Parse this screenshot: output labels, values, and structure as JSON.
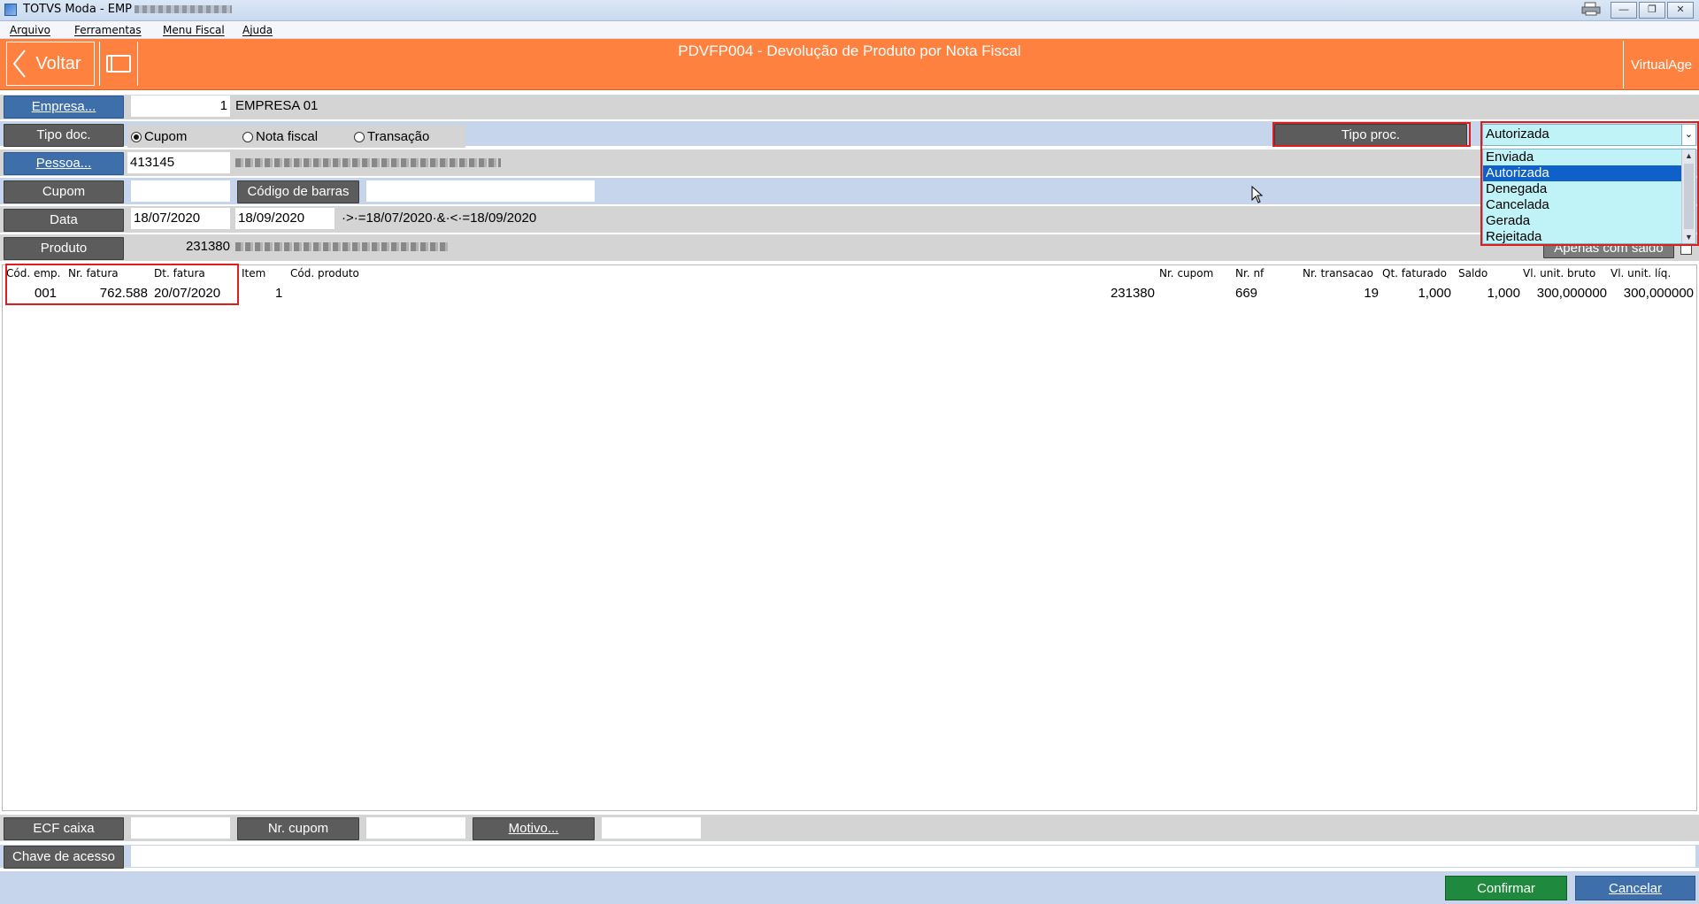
{
  "window": {
    "title": "TOTVS Moda - EMP"
  },
  "menu": [
    "Arquivo",
    "Ferramentas",
    "Menu Fiscal",
    "Ajuda"
  ],
  "header": {
    "back_label": "Voltar",
    "title": "PDVFP004 - Devolução de Produto por Nota Fiscal",
    "brand_label": "VirtualAge"
  },
  "form": {
    "empresa": {
      "button": "Empresa...",
      "code": "1",
      "name": "EMPRESA 01"
    },
    "tipo_doc": {
      "button": "Tipo doc.",
      "options": [
        "Cupom",
        "Nota fiscal",
        "Transação"
      ],
      "selected": "Cupom"
    },
    "tipo_proc": {
      "button": "Tipo proc.",
      "selected": "Autorizada",
      "options": [
        "Enviada",
        "Autorizada",
        "Denegada",
        "Cancelada",
        "Gerada",
        "Rejeitada"
      ]
    },
    "pessoa": {
      "button": "Pessoa...",
      "code": "413145"
    },
    "cupom": {
      "button": "Cupom",
      "value": "",
      "barcode_button": "Código de barras",
      "barcode_value": ""
    },
    "data": {
      "button": "Data",
      "from": "18/07/2020",
      "to": "18/09/2020",
      "filter": "·>·=18/07/2020·&·<·=18/09/2020"
    },
    "produto": {
      "button": "Produto",
      "code": "231380",
      "apenas_saldo_label": "Apenas com saldo"
    }
  },
  "grid": {
    "columns": [
      "Cód. emp.",
      "Nr. fatura",
      "Dt. fatura",
      "Item",
      "Cód. produto",
      "Nr. cupom",
      "Nr. nf",
      "Nr. transacao",
      "Qt. faturado",
      "Saldo",
      "Vl. unit. bruto",
      "Vl. unit. líq."
    ],
    "rows": [
      {
        "cod_emp": "001",
        "nr_fatura": "762.588",
        "dt_fatura": "20/07/2020",
        "item": "1",
        "cod_produto": "231380",
        "nr_cupom": "",
        "nr_nf": "669",
        "nr_transacao": "19",
        "qt_faturado": "1,000",
        "saldo": "1,000",
        "vl_bruto": "300,000000",
        "vl_liq": "300,000000"
      }
    ]
  },
  "footer": {
    "ecf_caixa": "ECF caixa",
    "nr_cupom": "Nr. cupom",
    "motivo": "Motivo...",
    "chave": "Chave de acesso",
    "confirm": "Confirmar",
    "cancel": "Cancelar"
  },
  "colors": {
    "header": "#ff8140",
    "button_grey": "#5c5c5c",
    "button_blue": "#3e6faa",
    "confirm_green": "#1f8a3d",
    "dropdown_bg": "#bff3f7",
    "highlight": "#e01c1c"
  }
}
